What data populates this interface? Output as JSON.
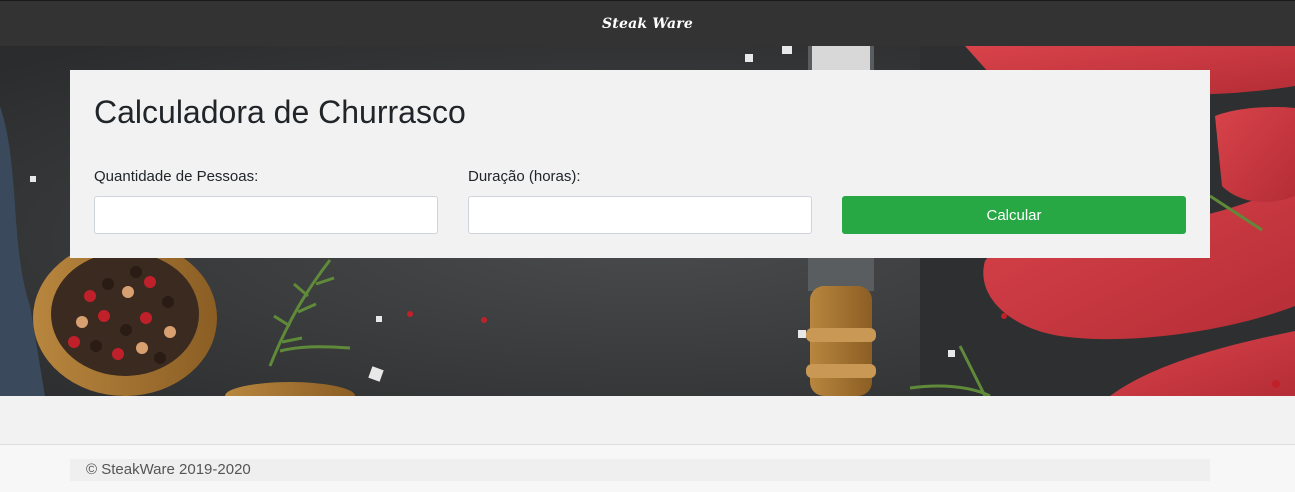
{
  "navbar": {
    "brand": "Steak Ware"
  },
  "calculator": {
    "title": "Calculadora de Churrasco",
    "people_label": "Quantidade de Pessoas:",
    "people_value": "",
    "duration_label": "Duração (horas):",
    "duration_value": "",
    "submit_label": "Calcular"
  },
  "footer": {
    "text": "© SteakWare 2019-2020"
  },
  "colors": {
    "navbar": "#333333",
    "button": "#28a745",
    "card": "#f2f2f2"
  }
}
